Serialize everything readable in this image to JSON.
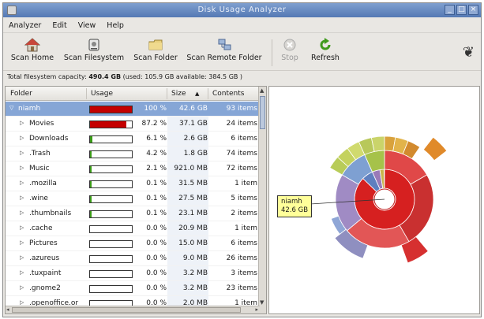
{
  "window": {
    "title": "Disk Usage Analyzer",
    "buttons": [
      "_",
      "□",
      "×"
    ]
  },
  "menubar": [
    "Analyzer",
    "Edit",
    "View",
    "Help"
  ],
  "toolbar": {
    "scan_home": "Scan Home",
    "scan_filesystem": "Scan Filesystem",
    "scan_folder": "Scan Folder",
    "scan_remote": "Scan Remote Folder",
    "stop": "Stop",
    "refresh": "Refresh"
  },
  "capacity": {
    "prefix": "Total filesystem capacity:",
    "total": "490.4 GB",
    "rest": "(used: 105.9 GB available: 384.5 GB )"
  },
  "columns": {
    "folder": "Folder",
    "usage": "Usage",
    "size": "Size",
    "contents": "Contents",
    "sort_indicator": "▲"
  },
  "rows": [
    {
      "name": "niamh",
      "percent": "100 %",
      "size": "42.6 GB",
      "contents": "93 items",
      "usage": 1.0,
      "color": "#c40000",
      "expander": "▽",
      "selected": true,
      "root": true
    },
    {
      "name": "Movies",
      "percent": "87.2 %",
      "size": "37.1 GB",
      "contents": "24 items",
      "usage": 0.872,
      "color": "#c40000",
      "expander": "▷"
    },
    {
      "name": "Downloads",
      "percent": "6.1 %",
      "size": "2.6 GB",
      "contents": "6 items",
      "usage": 0.061,
      "color": "#3a9a17",
      "expander": "▷"
    },
    {
      "name": ".Trash",
      "percent": "4.2 %",
      "size": "1.8 GB",
      "contents": "74 items",
      "usage": 0.042,
      "color": "#3a9a17",
      "expander": "▷"
    },
    {
      "name": "Music",
      "percent": "2.1 %",
      "size": "921.0 MB",
      "contents": "72 items",
      "usage": 0.021,
      "color": "#3a9a17",
      "expander": "▷"
    },
    {
      "name": ".mozilla",
      "percent": "0.1 %",
      "size": "31.5 MB",
      "contents": "1 item",
      "usage": 0.001,
      "color": "#3a9a17",
      "expander": "▷"
    },
    {
      "name": ".wine",
      "percent": "0.1 %",
      "size": "27.5 MB",
      "contents": "5 items",
      "usage": 0.001,
      "color": "#3a9a17",
      "expander": "▷"
    },
    {
      "name": ".thumbnails",
      "percent": "0.1 %",
      "size": "23.1 MB",
      "contents": "2 items",
      "usage": 0.001,
      "color": "#3a9a17",
      "expander": "▷"
    },
    {
      "name": ".cache",
      "percent": "0.0 %",
      "size": "20.9 MB",
      "contents": "1 item",
      "usage": 0.0,
      "color": "#3a9a17",
      "expander": "▷"
    },
    {
      "name": "Pictures",
      "percent": "0.0 %",
      "size": "15.0 MB",
      "contents": "6 items",
      "usage": 0.0,
      "color": "#3a9a17",
      "expander": "▷"
    },
    {
      "name": ".azureus",
      "percent": "0.0 %",
      "size": "9.0 MB",
      "contents": "26 items",
      "usage": 0.0,
      "color": "#3a9a17",
      "expander": "▷"
    },
    {
      "name": ".tuxpaint",
      "percent": "0.0 %",
      "size": "3.2 MB",
      "contents": "3 items",
      "usage": 0.0,
      "color": "#3a9a17",
      "expander": "▷"
    },
    {
      "name": ".gnome2",
      "percent": "0.0 %",
      "size": "3.2 MB",
      "contents": "23 items",
      "usage": 0.0,
      "color": "#3a9a17",
      "expander": "▷"
    },
    {
      "name": ".openoffice.or",
      "percent": "0.0 %",
      "size": "2.0 MB",
      "contents": "1 item",
      "usage": 0.0,
      "color": "#3a9a17",
      "expander": "▷"
    }
  ],
  "ring_chart": {
    "tooltip_name": "niamh",
    "tooltip_size": "42.6 GB"
  },
  "colors": {
    "selection": "#86a6d6",
    "usage_high": "#c40000",
    "usage_low": "#3a9a17",
    "tooltip_bg": "#ffff9a"
  }
}
